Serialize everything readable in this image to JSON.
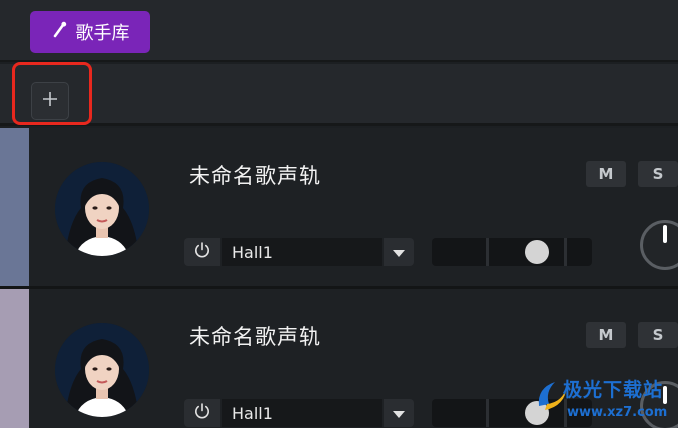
{
  "toolbar": {
    "library_label": "歌手库",
    "library_icon": "microphone-icon",
    "accent": "#7a25b8"
  },
  "add_track": {
    "icon": "plus-icon",
    "highlight_color": "#e8281e"
  },
  "tracks": [
    {
      "name": "未命名歌声轨",
      "color": "#6a7696",
      "mute_label": "M",
      "solo_label": "S",
      "reverb": "Hall1",
      "slider_value": 0.67
    },
    {
      "name": "未命名歌声轨",
      "color": "#a69db3",
      "mute_label": "M",
      "solo_label": "S",
      "reverb": "Hall1",
      "slider_value": 0.67
    }
  ],
  "watermark": {
    "text": "极光下载站",
    "url": "www.xz7.com"
  }
}
